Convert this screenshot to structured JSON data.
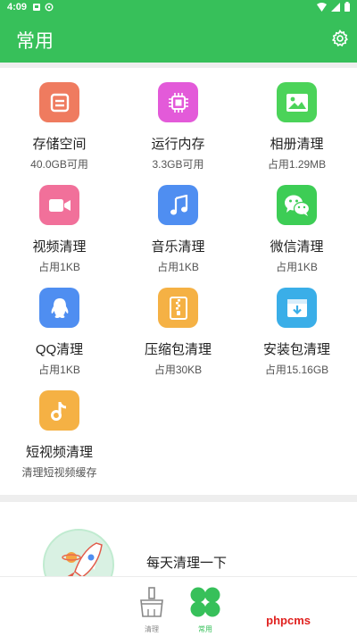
{
  "status": {
    "time": "4:09"
  },
  "header": {
    "title": "常用"
  },
  "tools": [
    {
      "name": "存储空间",
      "sub": "40.0GB可用",
      "icon": "storage-icon",
      "color": "#ef7b5f"
    },
    {
      "name": "运行内存",
      "sub": "3.3GB可用",
      "icon": "memory-chip-icon",
      "color": "#e35ad9"
    },
    {
      "name": "相册清理",
      "sub": "占用1.29MB",
      "icon": "photo-icon",
      "color": "#4bd359"
    },
    {
      "name": "视频清理",
      "sub": "占用1KB",
      "icon": "video-camera-icon",
      "color": "#f1709a"
    },
    {
      "name": "音乐清理",
      "sub": "占用1KB",
      "icon": "music-note-icon",
      "color": "#4f8ef1"
    },
    {
      "name": "微信清理",
      "sub": "占用1KB",
      "icon": "wechat-icon",
      "color": "#3dcd55"
    },
    {
      "name": "QQ清理",
      "sub": "占用1KB",
      "icon": "qq-icon",
      "color": "#4f8ef1"
    },
    {
      "name": "压缩包清理",
      "sub": "占用30KB",
      "icon": "zip-archive-icon",
      "color": "#f5b144"
    },
    {
      "name": "安装包清理",
      "sub": "占用15.16GB",
      "icon": "apk-package-icon",
      "color": "#3aaee8"
    },
    {
      "name": "短视频清理",
      "sub": "清理短视频缓存",
      "icon": "tiktok-icon",
      "color": "#f5b144"
    }
  ],
  "promo": {
    "text": "每天清理一下",
    "icon": "rocket-icon"
  },
  "nav": [
    {
      "label": "清理",
      "icon": "broom-icon"
    },
    {
      "label": "常用",
      "icon": "clover-icon"
    }
  ],
  "watermark": "phpcms"
}
